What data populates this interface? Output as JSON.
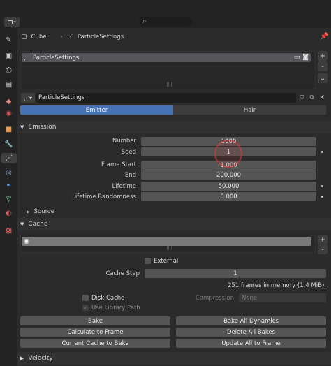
{
  "topbar": {
    "editor_icon": "properties-editor-icon",
    "search_icon": "search-icon"
  },
  "breadcrumb": {
    "object": "Cube",
    "particle": "ParticleSettings",
    "pin_icon": "pin-icon"
  },
  "particle_list": {
    "selected": "ParticleSettings",
    "add_label": "+",
    "remove_label": "-",
    "menu_label": "⌄"
  },
  "settings_field": {
    "value": "ParticleSettings"
  },
  "tabs": [
    {
      "label": "Emitter"
    },
    {
      "label": "Hair"
    }
  ],
  "emission": {
    "title": "Emission",
    "rows": [
      {
        "label": "Number",
        "value": "1000"
      },
      {
        "label": "Seed",
        "value": "1"
      },
      {
        "label": "Frame Start",
        "value": "1.000"
      },
      {
        "label": "End",
        "value": "200.000"
      },
      {
        "label": "Lifetime",
        "value": "50.000"
      },
      {
        "label": "Lifetime Randomness",
        "value": "0.000"
      }
    ],
    "source_label": "Source"
  },
  "cache": {
    "title": "Cache",
    "external_label": "External",
    "cache_step_label": "Cache Step",
    "cache_step_value": "1",
    "memory_info": "251 frames in memory (1.4 MiB).",
    "disk_cache_label": "Disk Cache",
    "compression_label": "Compression",
    "compression_value": "None",
    "library_path_label": "Use Library Path",
    "buttons": {
      "bake": "Bake",
      "bake_all": "Bake All Dynamics",
      "calc_to_frame": "Calculate to Frame",
      "delete_all": "Delete All Bakes",
      "current_cache": "Current Cache to Bake",
      "update_all": "Update All to Frame"
    }
  },
  "velocity": {
    "title": "Velocity"
  },
  "colors": {
    "accent": "#4772b3",
    "background": "#2b2b2b",
    "field": "#545454"
  }
}
